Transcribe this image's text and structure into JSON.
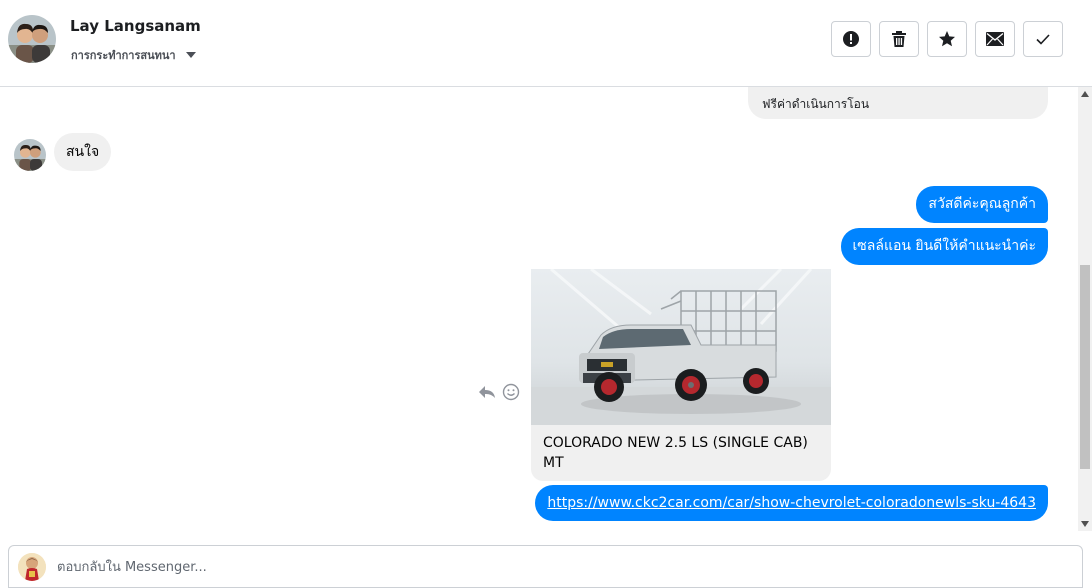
{
  "header": {
    "contact_name": "Lay Langsanam",
    "conversation_actions_label": "การกระทำการสนทนา",
    "buttons": [
      {
        "name": "report-button",
        "icon": "exclamation-circle-icon",
        "label": "Report spam"
      },
      {
        "name": "delete-button",
        "icon": "trash-icon",
        "label": "Delete"
      },
      {
        "name": "star-button",
        "icon": "star-icon",
        "label": "Star"
      },
      {
        "name": "mark-unread-button",
        "icon": "envelope-icon",
        "label": "Mark unread"
      },
      {
        "name": "mark-done-button",
        "icon": "checkmark-icon",
        "label": "Mark done"
      }
    ]
  },
  "messages": {
    "previous_card_text": "ฟรีค่าดำเนินการโอน",
    "incoming": [
      {
        "text": "สนใจ"
      }
    ],
    "outgoing": [
      {
        "text": "สวัสดีค่ะคุณลูกค้า"
      },
      {
        "text": "เซลล์แอน ยินดีให้คำแนะนำค่ะ"
      }
    ],
    "product_card": {
      "title": "COLORADO NEW 2.5 LS (SINGLE CAB) MT",
      "image_icon": "pickup-truck-photo"
    },
    "link_message": {
      "url": "https://www.ckc2car.com/car/show-chevrolet-coloradonewls-sku-4643"
    },
    "message_actions": [
      {
        "icon": "reply-icon"
      },
      {
        "icon": "smiley-icon"
      }
    ]
  },
  "composer": {
    "placeholder": "ตอบกลับใน Messenger..."
  },
  "colors": {
    "outgoing_bubble": "#0084ff",
    "incoming_bubble": "#f0f0f0",
    "border": "#ccd0d5"
  }
}
